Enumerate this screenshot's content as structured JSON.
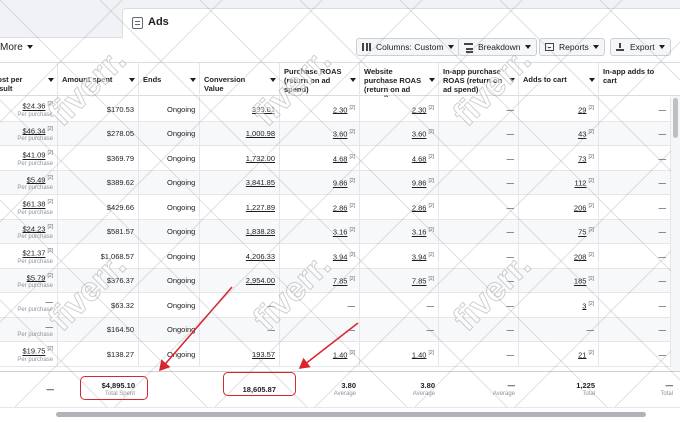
{
  "tab": {
    "label": "Ads"
  },
  "toolbar": {
    "more": "More",
    "columns": "Columns: Custom",
    "breakdown": "Breakdown",
    "reports": "Reports",
    "export": "Export"
  },
  "headers": [
    "Cost per result",
    "Amount spent",
    "Ends",
    "Conversion Value",
    "Purchase ROAS (return on ad spend)",
    "Website purchase ROAS (return on ad spend)",
    "In-app purchase ROAS (return on ad spend)",
    "Adds to cart",
    "In-app adds to cart"
  ],
  "rows": [
    {
      "cost": "$24.36",
      "cost_sub": "Per purchase",
      "spent": "$170.53",
      "ends": "Ongoing",
      "conv": "393.01",
      "roas": "2.30",
      "web_roas": "2.30",
      "inapp_roas": "—",
      "atc": "29",
      "inapp_atc": "—"
    },
    {
      "cost": "$46.34",
      "cost_sub": "Per purchase",
      "spent": "$278.05",
      "ends": "Ongoing",
      "conv": "1,000.98",
      "roas": "3.60",
      "web_roas": "3.60",
      "inapp_roas": "—",
      "atc": "43",
      "inapp_atc": "—"
    },
    {
      "cost": "$41.09",
      "cost_sub": "Per purchase",
      "spent": "$369.79",
      "ends": "Ongoing",
      "conv": "1,732.00",
      "roas": "4.68",
      "web_roas": "4.68",
      "inapp_roas": "—",
      "atc": "73",
      "inapp_atc": "—"
    },
    {
      "cost": "$5.49",
      "cost_sub": "Per purchase",
      "spent": "$389.62",
      "ends": "Ongoing",
      "conv": "3,841.85",
      "roas": "9.86",
      "web_roas": "9.86",
      "inapp_roas": "—",
      "atc": "112",
      "inapp_atc": "—"
    },
    {
      "cost": "$61.38",
      "cost_sub": "Per purchase",
      "spent": "$429.66",
      "ends": "Ongoing",
      "conv": "1,227.89",
      "roas": "2.86",
      "web_roas": "2.86",
      "inapp_roas": "—",
      "atc": "206",
      "inapp_atc": "—"
    },
    {
      "cost": "$24.23",
      "cost_sub": "Per purchase",
      "spent": "$581.57",
      "ends": "Ongoing",
      "conv": "1,838.28",
      "roas": "3.16",
      "web_roas": "3.16",
      "inapp_roas": "—",
      "atc": "75",
      "inapp_atc": "—"
    },
    {
      "cost": "$21.37",
      "cost_sub": "Per purchase",
      "spent": "$1,068.57",
      "ends": "Ongoing",
      "conv": "4,206.33",
      "roas": "3.94",
      "web_roas": "3.94",
      "inapp_roas": "—",
      "atc": "208",
      "inapp_atc": "—"
    },
    {
      "cost": "$5.79",
      "cost_sub": "Per purchase",
      "spent": "$376.37",
      "ends": "Ongoing",
      "conv": "2,954.00",
      "roas": "7.85",
      "web_roas": "7.85",
      "inapp_roas": "—",
      "atc": "185",
      "inapp_atc": "—"
    },
    {
      "cost": "—",
      "cost_sub": "Per purchase",
      "spent": "$63.32",
      "ends": "Ongoing",
      "conv": "—",
      "roas": "—",
      "web_roas": "—",
      "inapp_roas": "—",
      "atc": "3",
      "inapp_atc": "—"
    },
    {
      "cost": "—",
      "cost_sub": "Per purchase",
      "spent": "$164.50",
      "ends": "Ongoing",
      "conv": "—",
      "roas": "—",
      "web_roas": "—",
      "inapp_roas": "—",
      "atc": "—",
      "inapp_atc": "—"
    },
    {
      "cost": "$19.75",
      "cost_sub": "Per purchase",
      "spent": "$138.27",
      "ends": "Ongoing",
      "conv": "193.57",
      "roas": "1.40",
      "web_roas": "1.40",
      "inapp_roas": "—",
      "atc": "21",
      "inapp_atc": "—"
    }
  ],
  "totals": {
    "cost": "—",
    "spent": "$4,895.10",
    "spent_sub": "Total Spent",
    "conv": "18,605.87",
    "roas": "3.80",
    "roas_sub": "Average",
    "web_roas": "3.80",
    "web_roas_sub": "Average",
    "inapp_roas": "—",
    "inapp_roas_sub": "Average",
    "atc": "1,225",
    "atc_sub": "Total",
    "inapp_atc": "—",
    "inapp_atc_sub": "Total"
  },
  "watermark": "fiverr.",
  "colors": {
    "highlight": "#d9252e",
    "text": "#1c1e21",
    "muted": "#8d949e"
  }
}
